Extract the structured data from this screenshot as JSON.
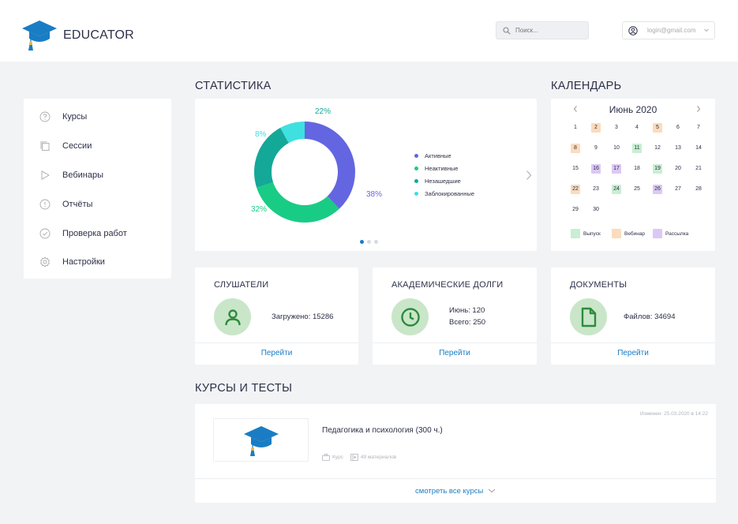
{
  "app": {
    "brand": "EDUCATOR"
  },
  "header": {
    "search_placeholder": "Поиск...",
    "account_email": "login@gmail.com"
  },
  "sidebar": {
    "items": [
      {
        "label": "Курсы",
        "icon": "question-circle-icon"
      },
      {
        "label": "Сессии",
        "icon": "copy-icon"
      },
      {
        "label": "Вебинары",
        "icon": "play-icon"
      },
      {
        "label": "Отчёты",
        "icon": "info-circle-icon"
      },
      {
        "label": "Проверка работ",
        "icon": "check-circle-icon"
      },
      {
        "label": "Настройки",
        "icon": "gear-icon"
      }
    ]
  },
  "stats": {
    "title": "СТАТИСТИКА",
    "chart_data": {
      "type": "pie",
      "donut": true,
      "slices": [
        {
          "label": "Активные",
          "value": 38,
          "display": "38%",
          "color": "#6366e0"
        },
        {
          "label": "Неактивные",
          "value": 32,
          "display": "32%",
          "color": "#19cc85"
        },
        {
          "label": "Незашедшие",
          "value": 22,
          "display": "22%",
          "color": "#14a898"
        },
        {
          "label": "Заблокированные",
          "value": 8,
          "display": "8%",
          "color": "#3ee0e0"
        }
      ],
      "legend_position": "right"
    },
    "pagination": {
      "count": 3,
      "active": 0
    }
  },
  "calendar": {
    "title": "КАЛЕНДАРЬ",
    "month_label": "Июнь 2020",
    "days": [
      {
        "d": "1"
      },
      {
        "d": "2",
        "type": "webinar"
      },
      {
        "d": "3"
      },
      {
        "d": "4"
      },
      {
        "d": "5",
        "type": "webinar"
      },
      {
        "d": "6"
      },
      {
        "d": "7"
      },
      {
        "d": "8",
        "type": "webinar"
      },
      {
        "d": "9"
      },
      {
        "d": "10"
      },
      {
        "d": "11",
        "type": "release"
      },
      {
        "d": "12"
      },
      {
        "d": "13"
      },
      {
        "d": "14"
      },
      {
        "d": "15"
      },
      {
        "d": "16",
        "type": "mailing"
      },
      {
        "d": "17",
        "type": "mailing"
      },
      {
        "d": "18"
      },
      {
        "d": "19",
        "type": "release"
      },
      {
        "d": "20"
      },
      {
        "d": "21"
      },
      {
        "d": "22",
        "type": "webinar"
      },
      {
        "d": "23"
      },
      {
        "d": "24",
        "type": "release"
      },
      {
        "d": "25"
      },
      {
        "d": "26",
        "type": "mailing"
      },
      {
        "d": "27"
      },
      {
        "d": "28"
      },
      {
        "d": "29"
      },
      {
        "d": "30"
      }
    ],
    "legend": [
      {
        "label": "Выпуск",
        "color": "#c8efd2"
      },
      {
        "label": "Вебинар",
        "color": "#fbdcbd"
      },
      {
        "label": "Рассылка",
        "color": "#dcc8f5"
      }
    ],
    "colors": {
      "release": "#c8efd2",
      "webinar": "#fbdcbd",
      "mailing": "#dcc8f5"
    }
  },
  "cards": {
    "listeners": {
      "title": "СЛУШАТЕЛИ",
      "line1": "Загружено: 15286",
      "link": "Перейти"
    },
    "debts": {
      "title": "АКАДЕМИЧЕСКИЕ ДОЛГИ",
      "line1": "Июнь: 120",
      "line2": "Всего: 250",
      "link": "Перейти"
    },
    "documents": {
      "title": "ДОКУМЕНТЫ",
      "line1": "Файлов: 34694",
      "link": "Перейти"
    }
  },
  "courses": {
    "title": "КУРСЫ И ТЕСТЫ",
    "item": {
      "name": "Педагогика и психология (300 ч.)",
      "modified": "Изменен: 25.03.2020 в 14:22",
      "type": "Курс",
      "materials": "49 материалов"
    },
    "view_all": "смотреть все курсы"
  }
}
